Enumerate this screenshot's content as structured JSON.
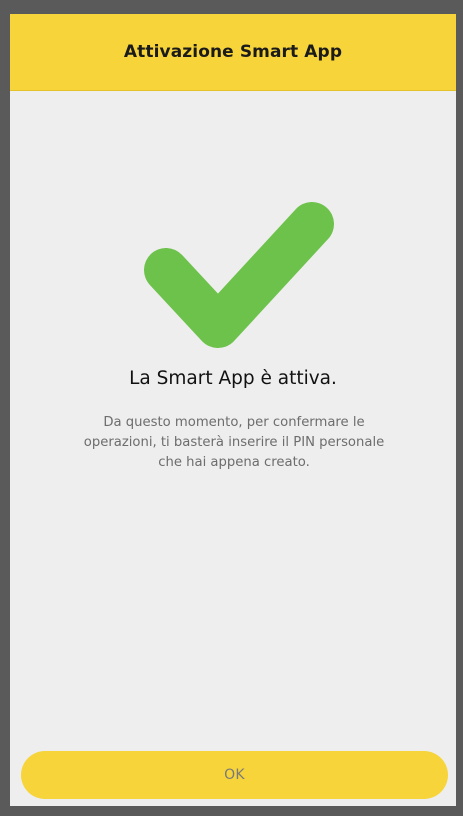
{
  "header": {
    "title": "Attivazione Smart App"
  },
  "confirmation": {
    "icon": "checkmark-icon",
    "title": "La Smart App è attiva.",
    "description_lines": [
      "Da questo momento, per confermare le",
      "operazioni, ti basterà inserire il PIN personale",
      "che hai appena creato."
    ]
  },
  "actions": {
    "ok_label": "OK"
  },
  "colors": {
    "header_background": "#f6d43a",
    "button_background": "#f6d43a",
    "checkmark": "#6cc24a",
    "screen_background": "#eeeeee"
  }
}
